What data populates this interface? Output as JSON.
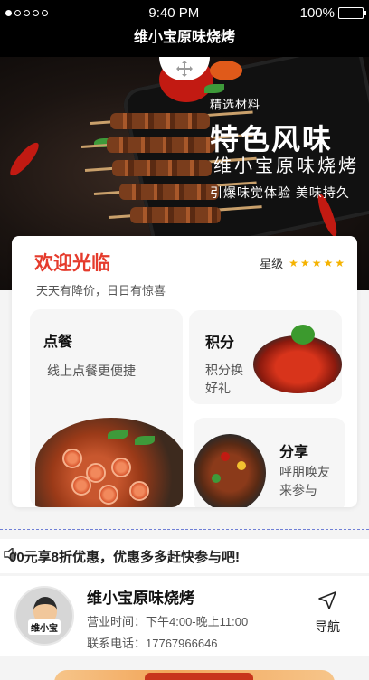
{
  "status_bar": {
    "time": "9:40 PM",
    "battery": "100%"
  },
  "header": {
    "title": "维小宝原味烧烤"
  },
  "banner": {
    "tag": "精选材料",
    "headline": "特色风味",
    "brand": "维小宝原味烧烤",
    "slogan": "引爆味觉体验 美味持久"
  },
  "welcome": {
    "title": "欢迎光临",
    "subtitle": "天天有降价，日日有惊喜",
    "rating_label": "星级",
    "rating_stars": 5
  },
  "tiles": {
    "order": {
      "title": "点餐",
      "desc": "线上点餐更便捷"
    },
    "points": {
      "title": "积分",
      "desc": "积分换好礼"
    },
    "share": {
      "title": "分享",
      "desc": "呼朋唤友来参与"
    }
  },
  "notice": {
    "text": "00元享8折优惠，优惠多多赶快参与吧!"
  },
  "store": {
    "logo_text": "维小宝",
    "name": "维小宝原味烧烤",
    "hours": "营业时间：下午4:00-晚上11:00",
    "phone": "联系电话：17767966646",
    "nav_label": "导航"
  },
  "colors": {
    "accent": "#e53b2c",
    "star": "#f5b301"
  }
}
